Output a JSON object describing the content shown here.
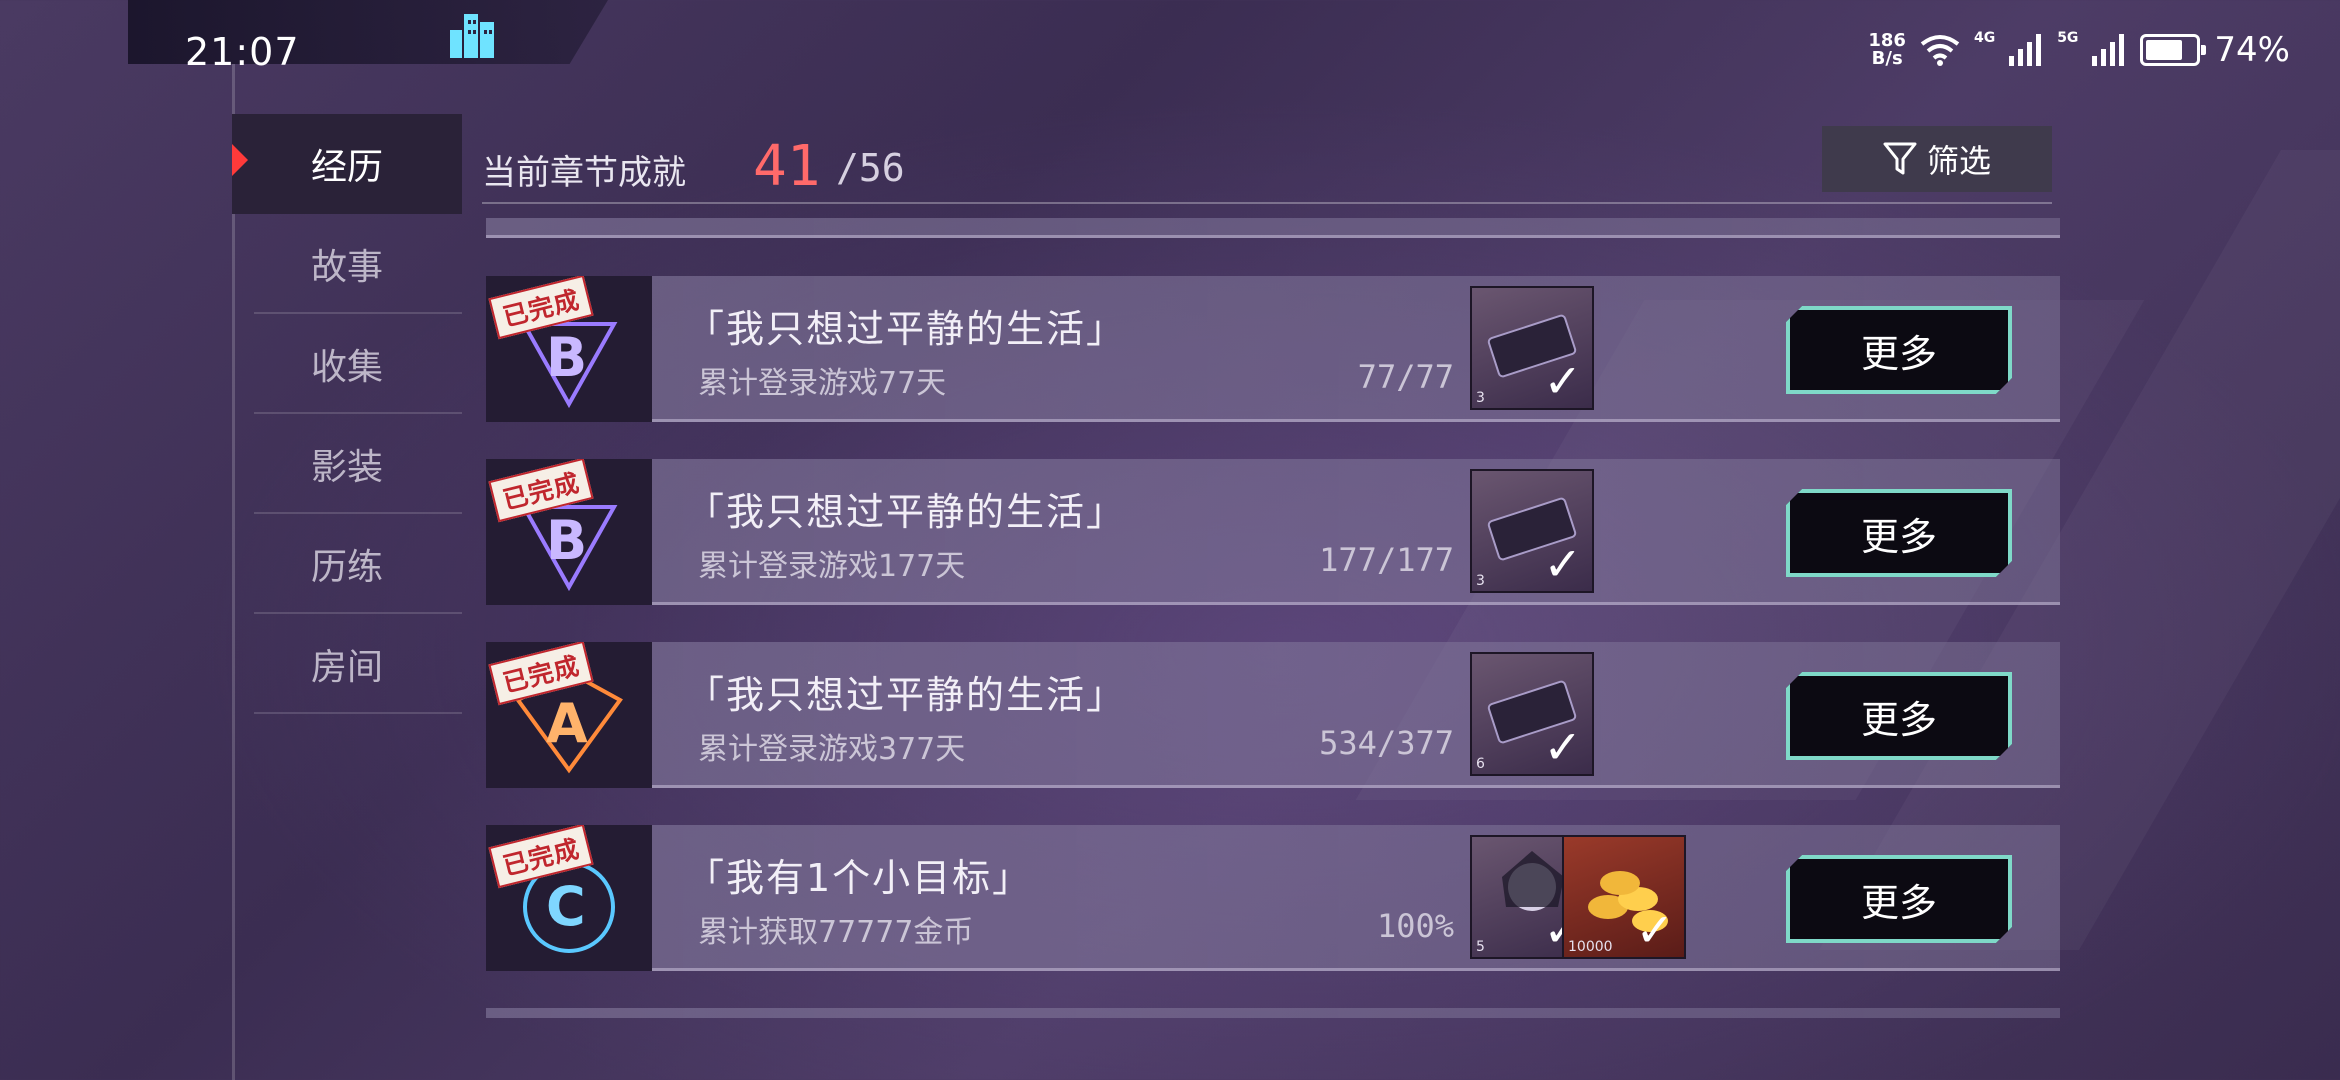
{
  "status_bar": {
    "time": "21:07",
    "net_speed_value": "186",
    "net_speed_unit": "B/s",
    "signal_1": "4G",
    "signal_2": "5G",
    "battery_percent": "74%",
    "battery_level": 0.74
  },
  "sidebar": {
    "items": [
      {
        "label": "经历",
        "active": true
      },
      {
        "label": "故事",
        "active": false
      },
      {
        "label": "收集",
        "active": false
      },
      {
        "label": "影装",
        "active": false
      },
      {
        "label": "历练",
        "active": false
      },
      {
        "label": "房间",
        "active": false
      }
    ]
  },
  "header": {
    "label": "当前章节成就",
    "count": "41",
    "total": "/56",
    "filter_label": "筛选"
  },
  "achievements": [
    {
      "done_tag": "已完成",
      "grade": "B",
      "grade_color": "#9a7bff",
      "title": "「我只想过平静的生活」",
      "description": "累计登录游戏77天",
      "progress": "77/77",
      "rewards": [
        {
          "qty": "3"
        }
      ],
      "more_label": "更多"
    },
    {
      "done_tag": "已完成",
      "grade": "B",
      "grade_color": "#9a7bff",
      "title": "「我只想过平静的生活」",
      "description": "累计登录游戏177天",
      "progress": "177/177",
      "rewards": [
        {
          "qty": "3"
        }
      ],
      "more_label": "更多"
    },
    {
      "done_tag": "已完成",
      "grade": "A",
      "grade_color": "#ff8a3a",
      "title": "「我只想过平静的生活」",
      "description": "累计登录游戏377天",
      "progress": "534/377",
      "rewards": [
        {
          "qty": "6"
        }
      ],
      "more_label": "更多"
    },
    {
      "done_tag": "已完成",
      "grade": "C",
      "grade_color": "#5ac8ff",
      "title": "「我有1个小目标」",
      "description": "累计获取77777金币",
      "progress": "100%",
      "rewards": [
        {
          "qty": "5"
        },
        {
          "qty": "10000"
        }
      ],
      "more_label": "更多"
    }
  ],
  "icons": {
    "filter": "filter-funnel-icon",
    "check": "check-icon",
    "city": "city-building-icon",
    "wifi": "wifi-icon",
    "signal": "signal-bars-icon",
    "battery": "battery-icon"
  },
  "colors": {
    "accent_red": "#ff3a3a",
    "count_red": "#ff6a6a",
    "more_border": "#7fd9c8"
  }
}
